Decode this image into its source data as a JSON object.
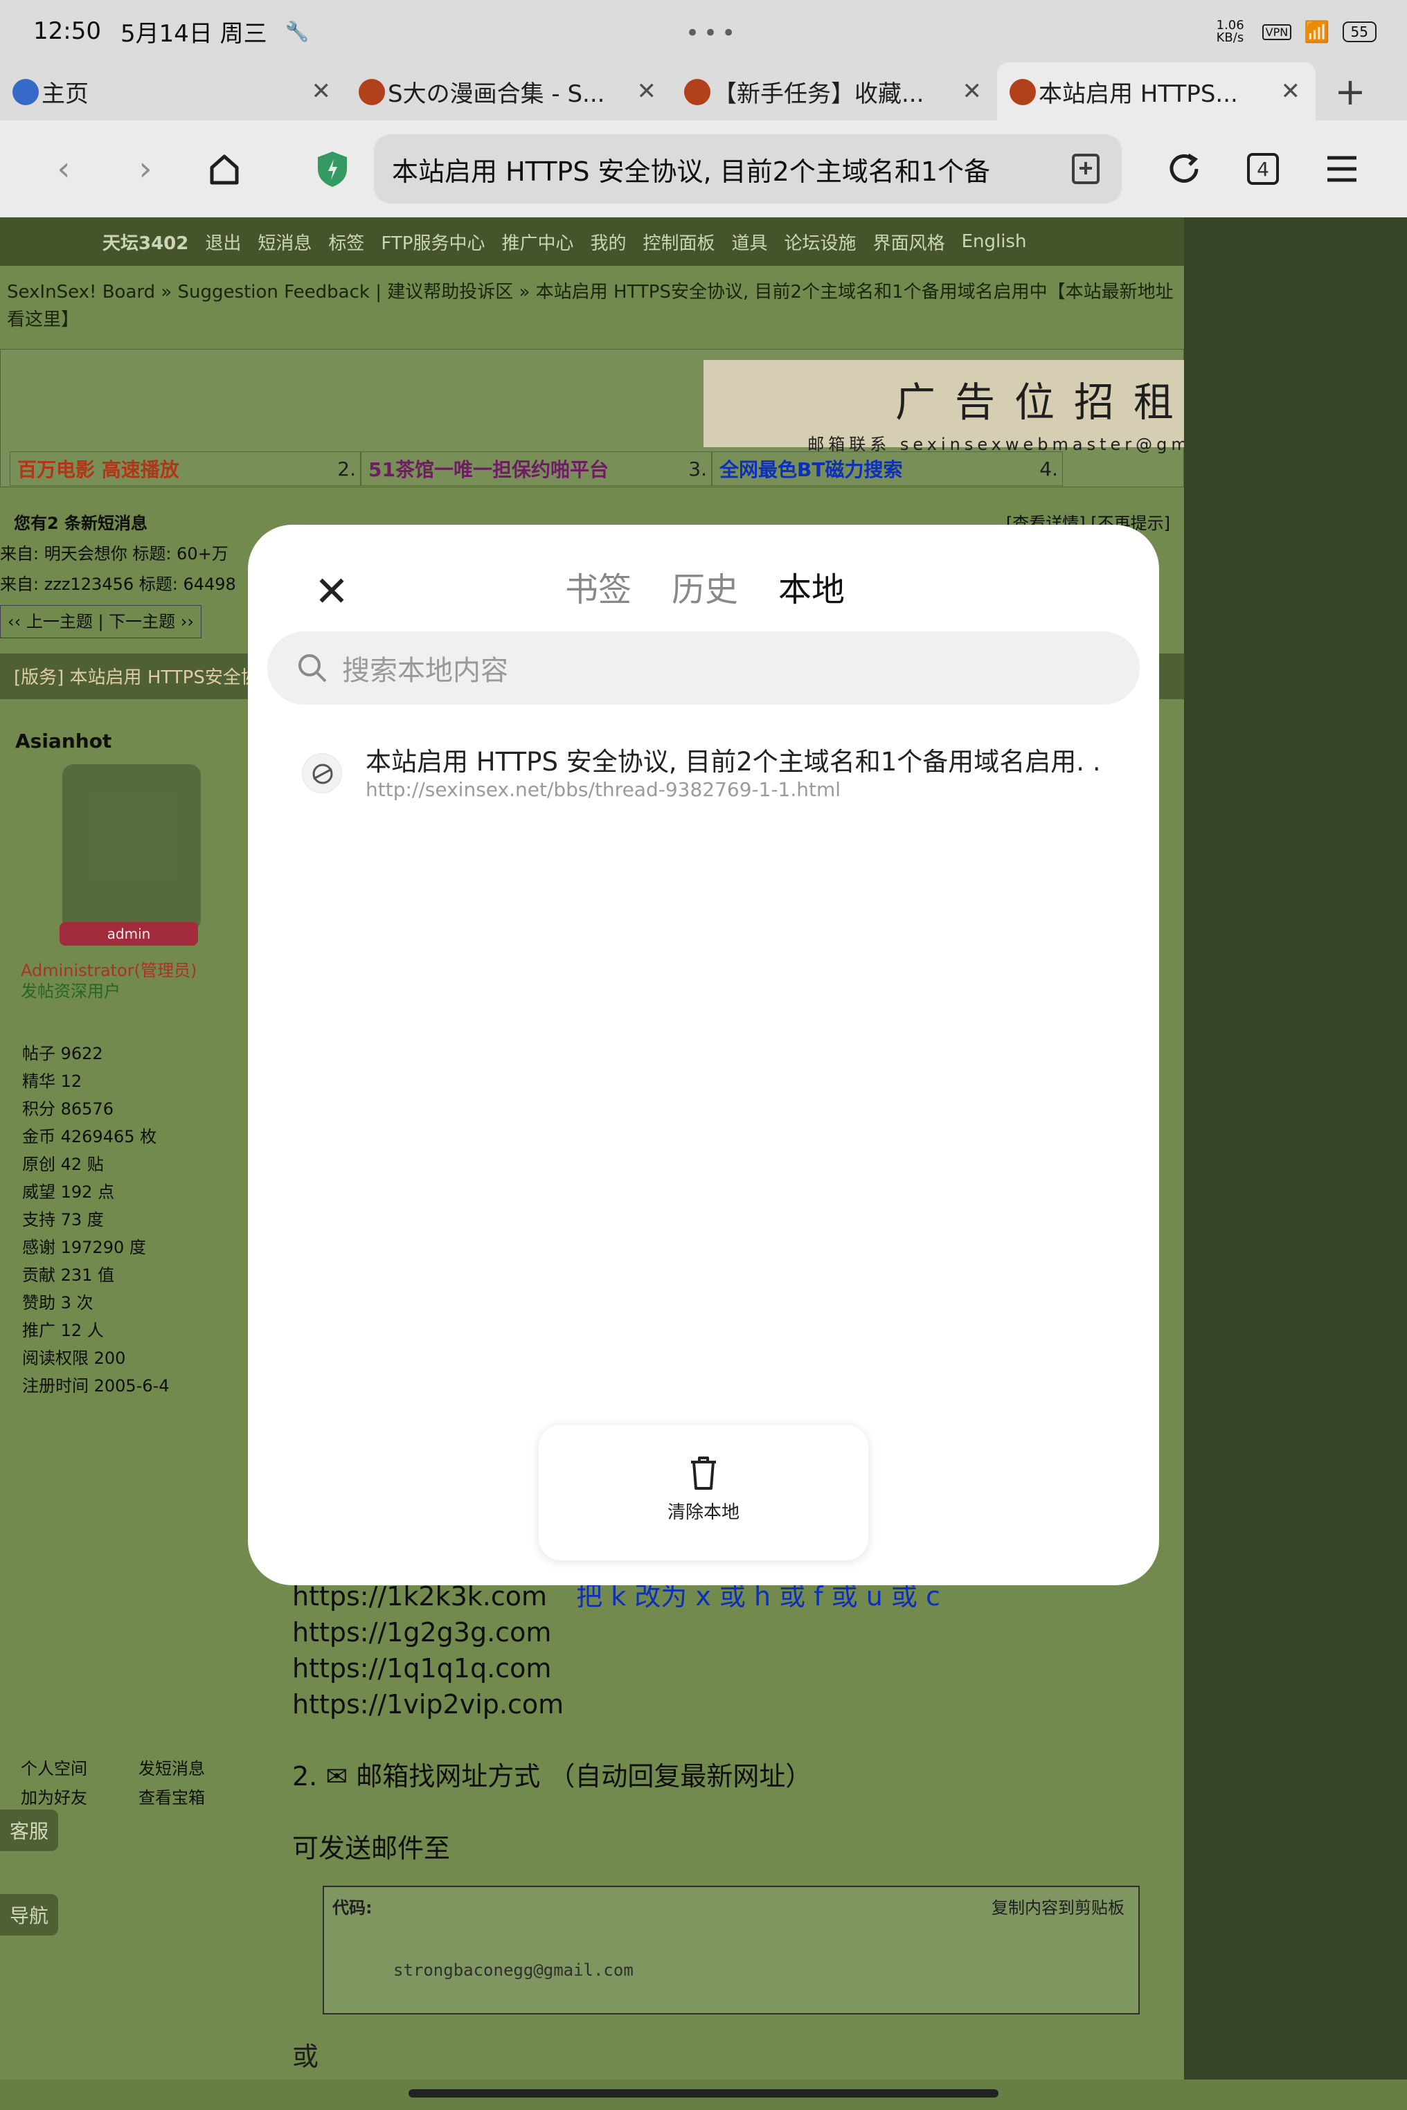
{
  "status": {
    "time": "12:50",
    "date": "5月14日 周三",
    "dots": "•••",
    "speed": "1.06 KB/s",
    "vpn": "VPN",
    "battery": "55"
  },
  "tabs": [
    {
      "label": "主页"
    },
    {
      "label": "S大の漫画合集 - S..."
    },
    {
      "label": "【新手任务】收藏..."
    },
    {
      "label": "本站启用 HTTPS..."
    }
  ],
  "toolbar": {
    "url_title": "本站启用 HTTPS 安全协议, 目前2个主域名和1个备",
    "tab_count": "4"
  },
  "icons": {
    "back": "back-arrow-icon",
    "forward": "forward-arrow-icon",
    "home": "home-icon",
    "shield": "shield-icon",
    "bookmark": "bookmark-add-icon",
    "reload": "reload-icon",
    "menu": "menu-icon"
  },
  "forum": {
    "nav": [
      "天坛3402",
      "退出",
      "短消息",
      "标签",
      "FTP服务中心",
      "推广中心",
      "我的",
      "控制面板",
      "道具",
      "论坛设施",
      "界面风格",
      "English"
    ],
    "breadcrumb": "SexInSex! Board » Suggestion Feedback | 建议帮助投诉区 » 本站启用 HTTPS安全协议, 目前2个主域名和1个备用域名启用中【本站最新地址看这里】",
    "ad_banner": "广告位招租",
    "ad_contact": "邮箱联系 sexinsexwebmaster@gmail.com",
    "ad_links": [
      {
        "text": "百万电影 高速播放",
        "num": "2."
      },
      {
        "text": "51茶馆一唯一担保约啪平台",
        "num": "3."
      },
      {
        "text": "全网最色BT磁力搜索",
        "num": "4."
      }
    ],
    "messages_title": "您有2 条新短消息",
    "messages_links": "[查看详情] [不再提示]",
    "msg1": "来自: 明天会想你    标题: 60+万",
    "msg2": "来自: zzz123456    标题: 64498",
    "prev_next": "‹‹ 上一主题 | 下一主题 ››",
    "post_title": "[版务] 本站启用 HTTPS安全协",
    "author": "Asianhot",
    "admin_badge": "admin",
    "role": "Administrator(管理员)",
    "group": "发帖资深用户",
    "stats": [
      "帖子 9622",
      "精华 12",
      "积分 86576",
      "金币 4269465 枚",
      "原创 42 贴",
      "威望 192 点",
      "支持 73 度",
      "感谢 197290 度",
      "贡献 231 值",
      "赞助 3 次",
      "推广 12 人",
      "阅读权限 200",
      "注册时间 2005-6-4"
    ],
    "profile_links": [
      "个人空间",
      "发短消息",
      "加为好友",
      "查看宝箱"
    ],
    "content_lines": [
      "https://1k2k3k.com",
      "https://1g2g3g.com",
      "https://1q1q1q.com",
      "https://1vip2vip.com"
    ],
    "content_hint": "把 k 改为 x 或 h 或 f 或 u 或 c",
    "email_heading": "2. ✉ 邮箱找网址方式 （自动回复最新网址）",
    "email_send": "可发送邮件至",
    "code_label": "代码:",
    "code_copy": "复制内容到剪贴板",
    "code_value": "strongbaconegg@gmail.com",
    "or": "或",
    "kefu": "客服",
    "daohang": "导航"
  },
  "modal": {
    "tabs": [
      "书签",
      "历史",
      "本地"
    ],
    "active_tab": "本地",
    "search_placeholder": "搜索本地内容",
    "items": [
      {
        "title": "本站启用 HTTPS 安全协议, 目前2个主域名和1个备用域名启用. .",
        "url": "http://sexinsex.net/bbs/thread-9382769-1-1.html"
      }
    ],
    "clear_label": "清除本地"
  }
}
